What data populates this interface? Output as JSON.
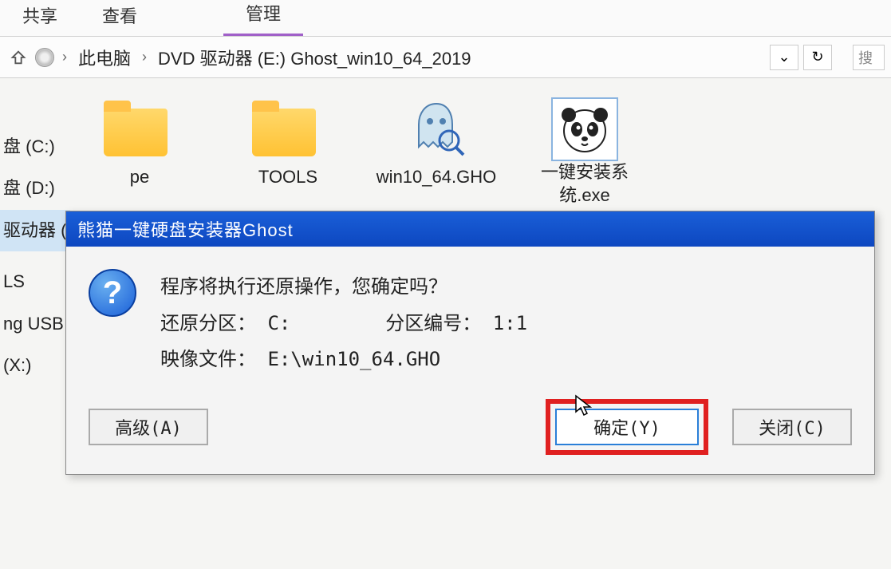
{
  "tabs": {
    "share": "共享",
    "view": "查看",
    "manage": "管理"
  },
  "breadcrumb": {
    "root": "此电脑",
    "drive": "DVD 驱动器 (E:) Ghost_win10_64_2019"
  },
  "search_placeholder": "搜",
  "sidebar": {
    "items": [
      "盘 (C:)",
      "盘 (D:)",
      "驱动器 (E:) Gh",
      "",
      "LS",
      "ng USB",
      "(X:)"
    ]
  },
  "files": [
    {
      "name": "pe",
      "type": "folder"
    },
    {
      "name": "TOOLS",
      "type": "folder"
    },
    {
      "name": "win10_64.GHO",
      "type": "gho"
    },
    {
      "name": "一键安装系统.exe",
      "type": "panda"
    }
  ],
  "dialog": {
    "title": "熊猫一键硬盘安装器Ghost",
    "msg_line1": "程序将执行还原操作，您确定吗？",
    "msg_line2_a": "还原分区：",
    "msg_line2_b": "C:",
    "msg_line2_c": "分区编号：",
    "msg_line2_d": "1:1",
    "msg_line3_a": "映像文件：",
    "msg_line3_b": "E:\\win10_64.GHO",
    "btn_advanced": "高级(A)",
    "btn_ok": "确定(Y)",
    "btn_close": "关闭(C)"
  }
}
